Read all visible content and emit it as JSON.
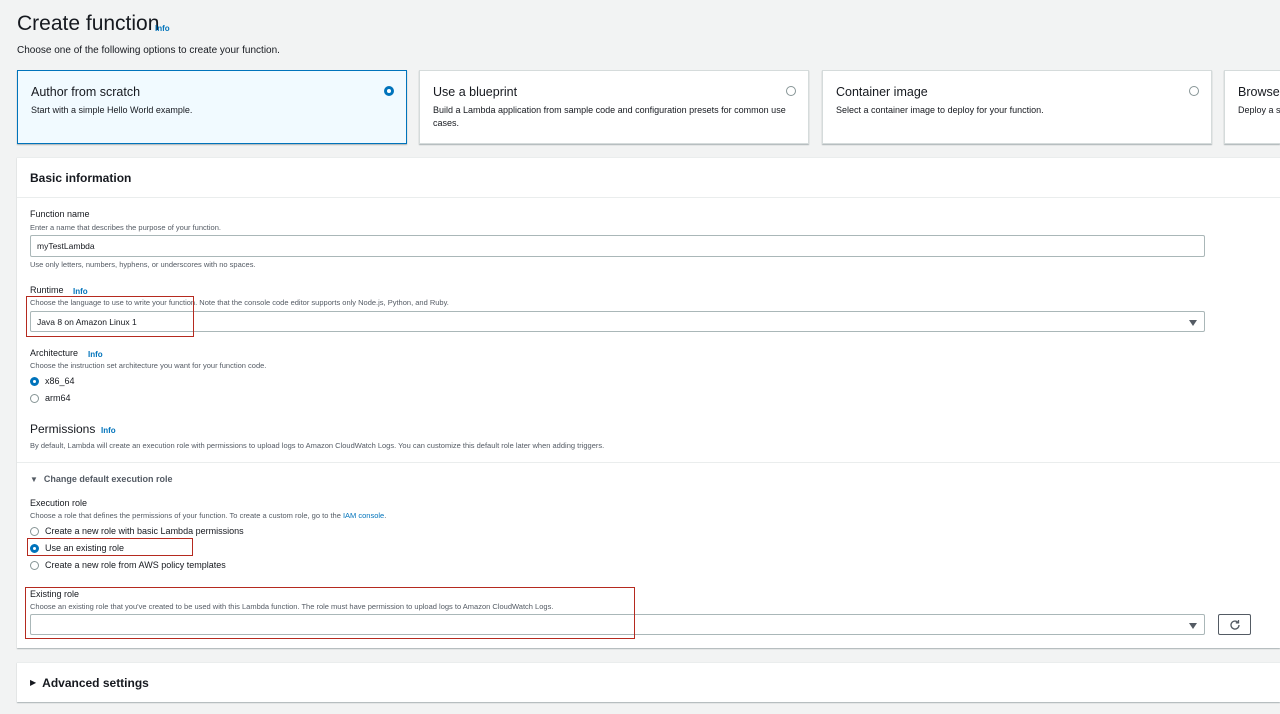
{
  "header": {
    "title": "Create function",
    "info": "Info",
    "subtitle": "Choose one of the following options to create your function."
  },
  "options": [
    {
      "title": "Author from scratch",
      "desc": "Start with a simple Hello World example.",
      "selected": true
    },
    {
      "title": "Use a blueprint",
      "desc": "Build a Lambda application from sample code and configuration presets for common use cases.",
      "selected": false
    },
    {
      "title": "Container image",
      "desc": "Select a container image to deploy for your function.",
      "selected": false
    },
    {
      "title": "Browse",
      "desc": "Deploy a s",
      "selected": false
    }
  ],
  "basic": {
    "heading": "Basic information",
    "function_name": {
      "label": "Function name",
      "desc": "Enter a name that describes the purpose of your function.",
      "value": "myTestLambda",
      "constraint": "Use only letters, numbers, hyphens, or underscores with no spaces."
    },
    "runtime": {
      "label": "Runtime",
      "info": "Info",
      "desc": "Choose the language to use to write your function. Note that the console code editor supports only Node.js, Python, and Ruby.",
      "value": "Java 8 on Amazon Linux 1"
    },
    "architecture": {
      "label": "Architecture",
      "info": "Info",
      "desc": "Choose the instruction set architecture you want for your function code.",
      "options": [
        "x86_64",
        "arm64"
      ],
      "selected": "x86_64"
    },
    "permissions": {
      "label": "Permissions",
      "info": "Info",
      "desc": "By default, Lambda will create an execution role with permissions to upload logs to Amazon CloudWatch Logs. You can customize this default role later when adding triggers."
    },
    "change_role": {
      "label": "Change default execution role"
    },
    "execution_role": {
      "label": "Execution role",
      "desc_prefix": "Choose a role that defines the permissions of your function. To create a custom role, go to the ",
      "desc_link": "IAM console",
      "desc_suffix": ".",
      "options": [
        "Create a new role with basic Lambda permissions",
        "Use an existing role",
        "Create a new role from AWS policy templates"
      ],
      "selected": "Use an existing role"
    },
    "existing_role": {
      "label": "Existing role",
      "desc": "Choose an existing role that you've created to be used with this Lambda function. The role must have permission to upload logs to Amazon CloudWatch Logs.",
      "value": ""
    }
  },
  "advanced": {
    "label": "Advanced settings"
  },
  "colors": {
    "accent": "#0073bb",
    "highlight": "#b52a1f",
    "background": "#f2f3f3"
  }
}
